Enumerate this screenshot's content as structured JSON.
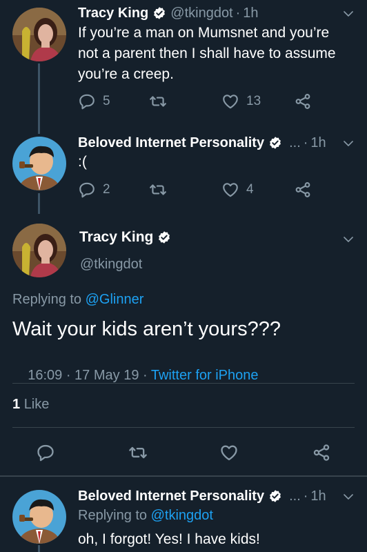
{
  "tweet1": {
    "name": "Tracy King",
    "handle": "@tkingdot",
    "time": "1h",
    "text": "If you’re a man on Mumsnet and you’re not a parent then I shall have to assume you’re a creep.",
    "replies": "5",
    "retweets": "",
    "likes": "13"
  },
  "tweet2": {
    "name": "Beloved Internet Personality",
    "time": "1h",
    "text": ":(",
    "replies": "2",
    "retweets": "",
    "likes": "4"
  },
  "focus": {
    "name": "Tracy King",
    "handle": "@tkingdot",
    "replying_prefix": "Replying to",
    "replying_to": "@Glinner",
    "text": "Wait your kids aren’t yours???",
    "timestamp": "16:09 · 17 May 19 · ",
    "client": "Twitter for iPhone",
    "likes_count": "1",
    "likes_label": "Like"
  },
  "tweet3": {
    "name": "Beloved Internet Personality",
    "time": "1h",
    "replying_prefix": "Replying to",
    "replying_to": "@tkingdot",
    "text": "oh, I forgot! Yes! I have kids!"
  },
  "common": {
    "dot": "·",
    "ellipsis": "..."
  },
  "colors": {
    "background": "#15202b",
    "text": "#ffffff",
    "muted": "#8899a6",
    "accent": "#1da1f2",
    "divider": "#38444d"
  },
  "icons": [
    "verified-badge-icon",
    "chevron-down-icon",
    "reply-icon",
    "retweet-icon",
    "like-icon",
    "share-icon"
  ]
}
